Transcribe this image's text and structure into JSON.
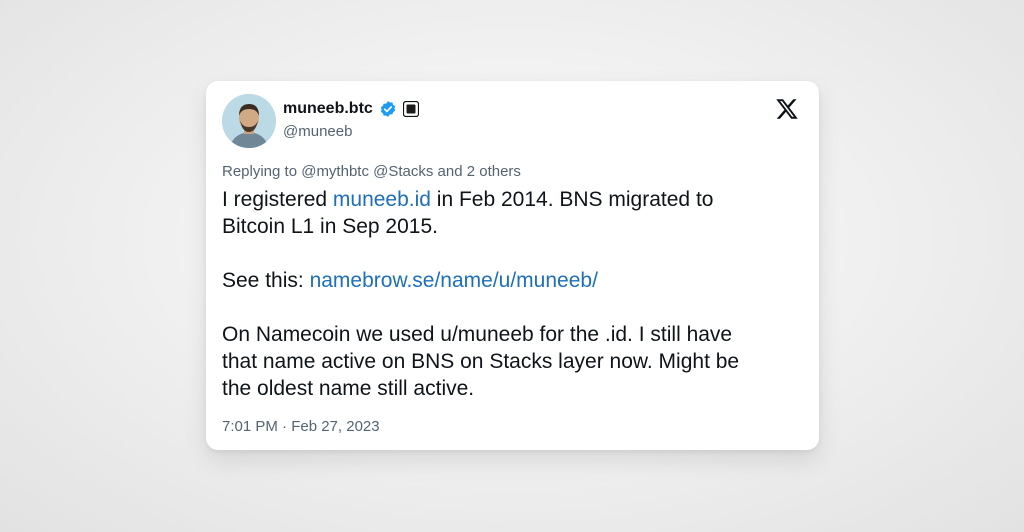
{
  "tweet": {
    "display_name": "muneeb.btc",
    "handle": "@muneeb",
    "reply_line": "Replying to @mythbtc @Stacks and 2 others",
    "line1_pre": "I registered ",
    "line1_link": "muneeb.id",
    "line1_post": " in Feb 2014. BNS migrated to",
    "line2": "Bitcoin L1 in Sep 2015.",
    "see_pre": "See this: ",
    "see_link": "namebrow.se/name/u/muneeb/",
    "para3_line1": "On Namecoin we used u/muneeb for the  .id. I still have",
    "para3_line2": "that name active on BNS on Stacks layer now. Might be",
    "para3_line3": "the oldest name still active.",
    "timestamp": "7:01 PM · Feb 27, 2023"
  },
  "icons": {
    "verified": "verified-badge-icon",
    "affiliate": "affiliate-square-icon",
    "brand": "x-logo-icon"
  },
  "colors": {
    "link": "#1d70b8",
    "verified": "#1d9bf0",
    "text": "#0f1419",
    "muted": "#536471"
  }
}
